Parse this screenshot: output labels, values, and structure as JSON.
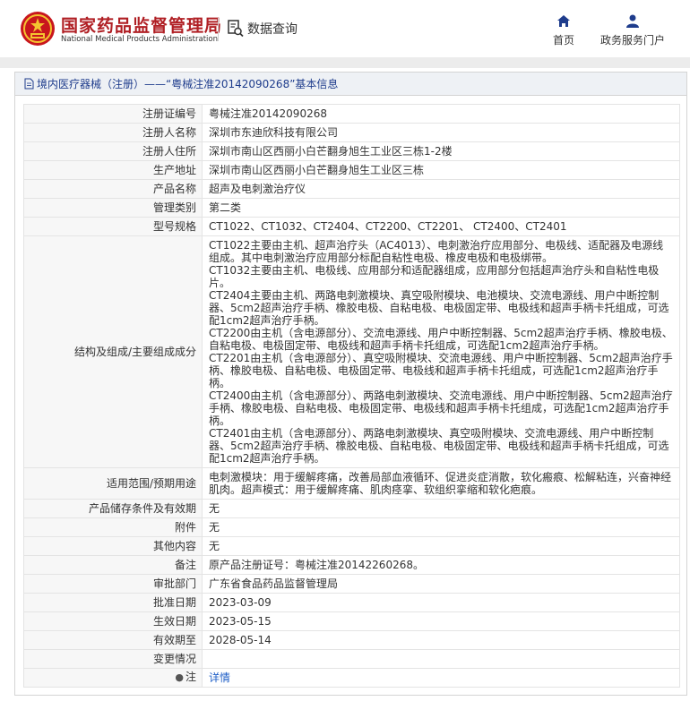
{
  "header": {
    "brand_cn": "国家药品监督管理局",
    "brand_en": "National Medical Products Administration",
    "query_label": "数据查询",
    "nav_home": "首页",
    "nav_gov": "政务服务门户"
  },
  "panel": {
    "title": "境内医疗器械（注册）——“粤械注准20142090268”基本信息"
  },
  "rows": [
    {
      "key": "注册证编号",
      "value": "粤械注准20142090268"
    },
    {
      "key": "注册人名称",
      "value": "深圳市东迪欣科技有限公司"
    },
    {
      "key": "注册人住所",
      "value": "深圳市南山区西丽小白芒翻身旭生工业区三栋1-2楼"
    },
    {
      "key": "生产地址",
      "value": "深圳市南山区西丽小白芒翻身旭生工业区三栋"
    },
    {
      "key": "产品名称",
      "value": "超声及电刺激治疗仪"
    },
    {
      "key": "管理类别",
      "value": "第二类"
    },
    {
      "key": "型号规格",
      "value": "CT1022、CT1032、CT2404、CT2200、CT2201、 CT2400、CT2401"
    },
    {
      "key": "结构及组成/主要组成成分",
      "value": "CT1022主要由主机、超声治疗头（AC4013）、电刺激治疗应用部分、电极线、适配器及电源线组成。其中电刺激治疗应用部分标配自粘性电极、橡皮电极和电极绑带。\nCT1032主要由主机、电极线、应用部分和适配器组成，应用部分包括超声治疗头和自粘性电极片。\nCT2404主要由主机、两路电刺激模块、真空吸附模块、电池模块、交流电源线、用户中断控制器、5cm2超声治疗手柄、橡胶电极、自粘电极、电极固定带、电极线和超声手柄卡托组成，可选配1cm2超声治疗手柄。\nCT2200由主机（含电源部分）、交流电源线、用户中断控制器、5cm2超声治疗手柄、橡胶电极、自粘电极、电极固定带、电极线和超声手柄卡托组成，可选配1cm2超声治疗手柄。\nCT2201由主机（含电源部分）、真空吸附模块、交流电源线、用户中断控制器、5cm2超声治疗手柄、橡胶电极、自粘电极、电极固定带、电极线和超声手柄卡托组成，可选配1cm2超声治疗手柄。\nCT2400由主机（含电源部分）、两路电刺激模块、交流电源线、用户中断控制器、5cm2超声治疗手柄、橡胶电极、自粘电极、电极固定带、电极线和超声手柄卡托组成，可选配1cm2超声治疗手柄。\nCT2401由主机（含电源部分）、两路电刺激模块、真空吸附模块、交流电源线、用户中断控制器、5cm2超声治疗手柄、橡胶电极、自粘电极、电极固定带、电极线和超声手柄卡托组成，可选配1cm2超声治疗手柄。"
    },
    {
      "key": "适用范围/预期用途",
      "value": "电刺激模块：用于缓解疼痛，改善局部血液循环、促进炎症消散，软化瘢痕、松解粘连，兴奋神经肌肉。超声模式：用于缓解疼痛、肌肉痉挛、软组织挛缩和软化疤痕。"
    },
    {
      "key": "产品储存条件及有效期",
      "value": "无"
    },
    {
      "key": "附件",
      "value": "无"
    },
    {
      "key": "其他内容",
      "value": "无"
    },
    {
      "key": "备注",
      "value": "原产品注册证号：粤械注准20142260268。"
    },
    {
      "key": "审批部门",
      "value": "广东省食品药品监督管理局"
    },
    {
      "key": "批准日期",
      "value": "2023-03-09"
    },
    {
      "key": "生效日期",
      "value": "2023-05-15"
    },
    {
      "key": "有效期至",
      "value": "2028-05-14"
    },
    {
      "key": "变更情况",
      "value": ""
    },
    {
      "key": "注",
      "value": "详情"
    }
  ],
  "icons": {
    "logo": "national-emblem-icon",
    "query": "search-document-icon",
    "home": "home-icon",
    "gov": "user-icon",
    "title_doc": "document-icon",
    "note": "lightbulb-icon"
  },
  "colors": {
    "brand_red": "#b01f24",
    "nav_blue": "#1e3c8c",
    "link_blue": "#1f5fc7"
  }
}
